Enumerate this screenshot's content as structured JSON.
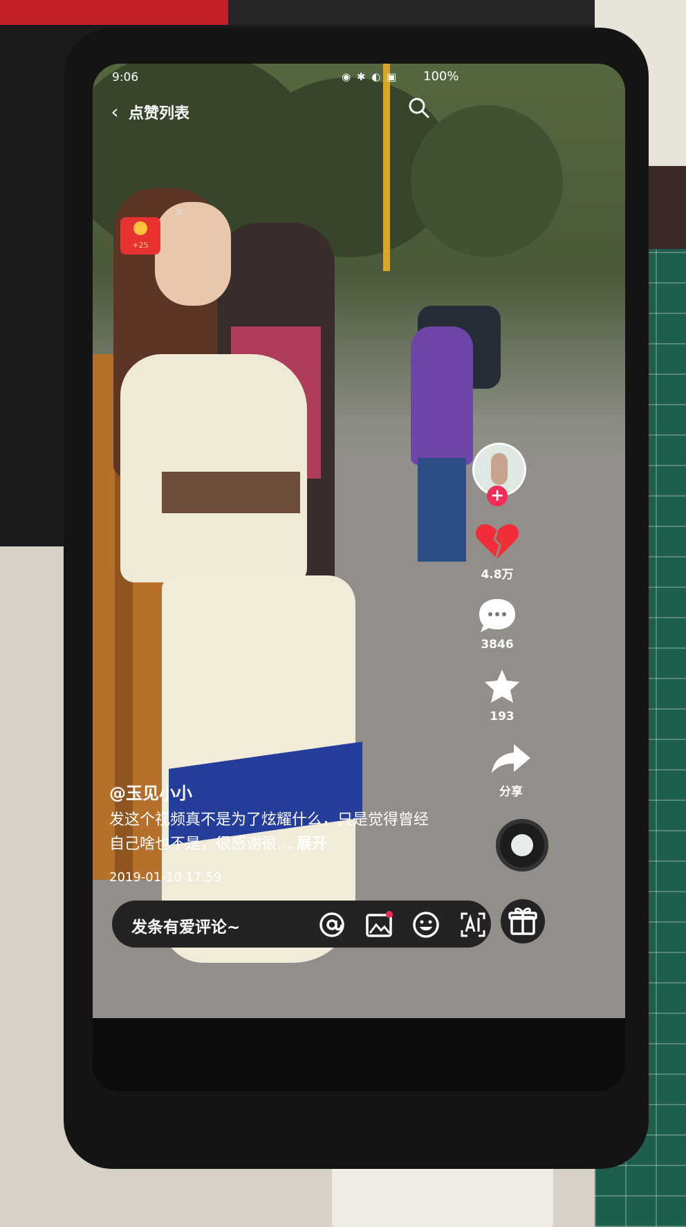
{
  "status_bar": {
    "time": "9:06",
    "battery": "100%"
  },
  "header": {
    "title": "点赞列表"
  },
  "red_envelope": {
    "amount": "+25"
  },
  "actions": {
    "likes": "4.8万",
    "comments": "3846",
    "favorites": "193",
    "share": "分享"
  },
  "post": {
    "author": "@玉见小小",
    "description": "发这个视频真不是为了炫耀什么，只是觉得曾经自己啥也不是，很感谢很…",
    "expand": "展开",
    "date": "2019-01-10 17:59"
  },
  "comment_bar": {
    "placeholder": "发条有爱评论~"
  },
  "colors": {
    "like_red": "#f22d3a",
    "follow_pink": "#f22d5a"
  },
  "icons": [
    "back-icon",
    "search-icon",
    "heart-icon",
    "comment-icon",
    "star-icon",
    "share-icon",
    "music-disc-icon",
    "at-icon",
    "image-icon",
    "emoji-icon",
    "ai-icon",
    "gift-icon"
  ]
}
